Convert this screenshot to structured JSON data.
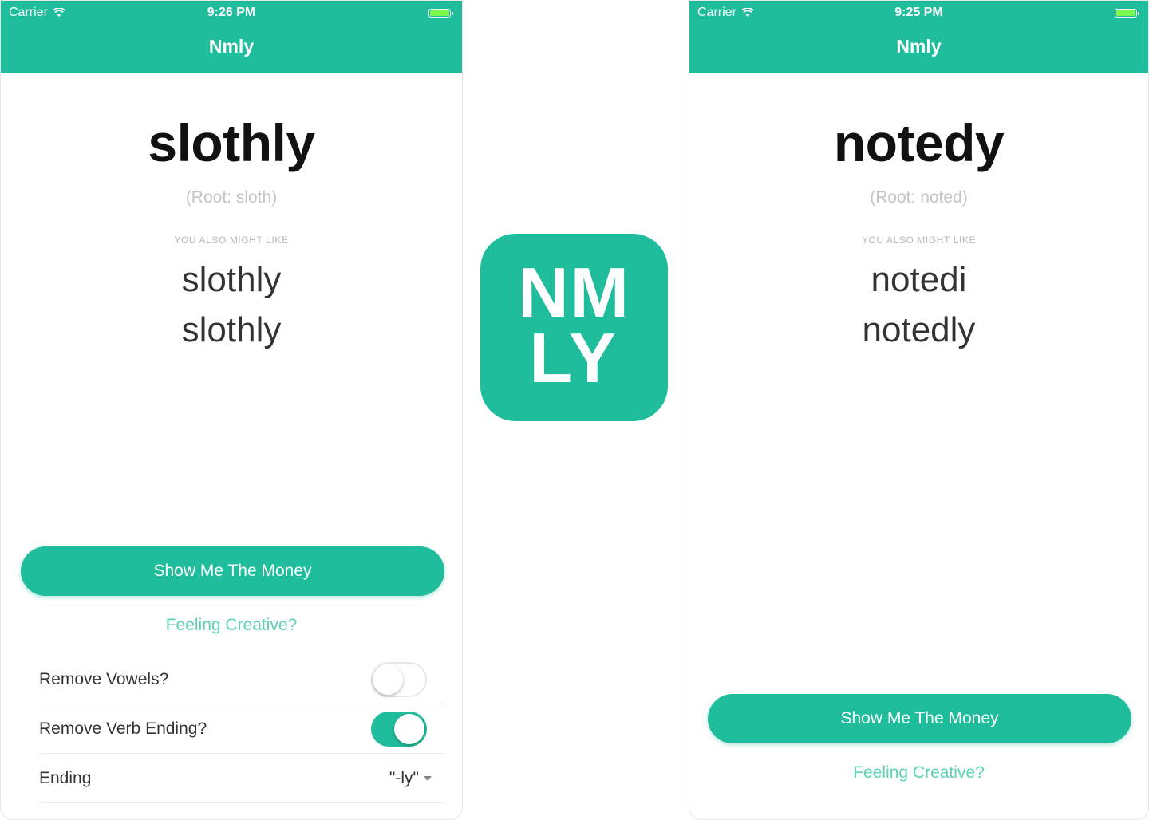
{
  "left_phone": {
    "status": {
      "carrier": "Carrier",
      "time": "9:26 PM"
    },
    "nav_title": "Nmly",
    "word": "slothly",
    "root": "(Root: sloth)",
    "suggest_label": "YOU ALSO MIGHT LIKE",
    "suggestions": [
      "slothly",
      "slothly"
    ],
    "money_button": "Show Me The Money",
    "creative_link": "Feeling Creative?",
    "settings": {
      "remove_vowels": {
        "label": "Remove Vowels?",
        "enabled": false
      },
      "remove_verb_ending": {
        "label": "Remove Verb Ending?",
        "enabled": true
      },
      "ending": {
        "label": "Ending",
        "value": "\"-ly\""
      }
    }
  },
  "app_icon": {
    "line1": "NM",
    "line2": "LY"
  },
  "right_phone": {
    "status": {
      "carrier": "Carrier",
      "time": "9:25 PM"
    },
    "nav_title": "Nmly",
    "word": "notedy",
    "root": "(Root: noted)",
    "suggest_label": "YOU ALSO MIGHT LIKE",
    "suggestions": [
      "notedi",
      "notedly"
    ],
    "money_button": "Show Me The Money",
    "creative_link": "Feeling Creative?"
  },
  "colors": {
    "brand": "#1fbd9b",
    "link": "#5dd1b6",
    "battery": "#7CFC4E"
  }
}
